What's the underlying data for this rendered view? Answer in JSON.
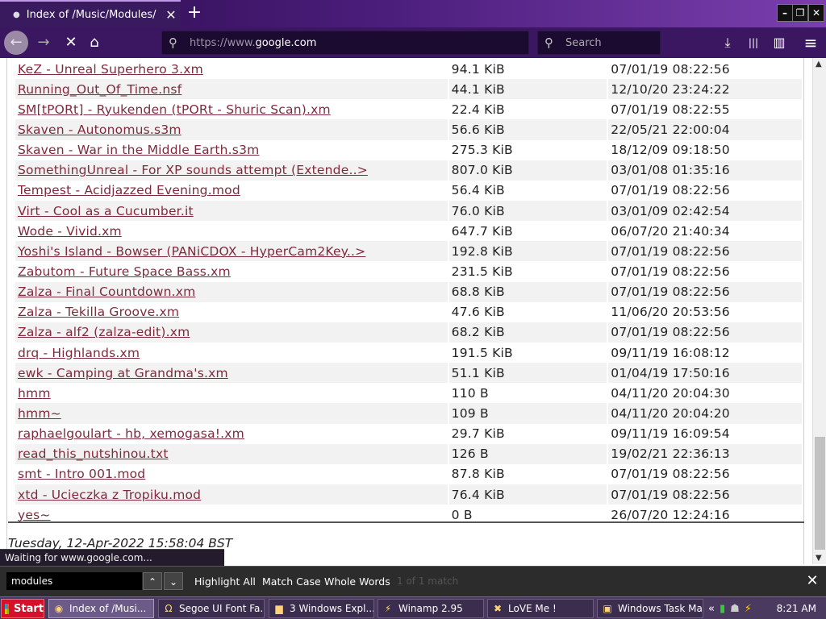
{
  "tab": {
    "title": "Index of /Music/Modules/",
    "close": "✕",
    "new": "+"
  },
  "window_controls": {
    "min": "–",
    "restore": "❐",
    "close": "✕"
  },
  "nav": {
    "back": "←",
    "forward": "→",
    "stop": "✕",
    "home": "⌂"
  },
  "url": {
    "prefix": "https://",
    "host_dim": "www.",
    "host": "google.com"
  },
  "search": {
    "placeholder": "Search"
  },
  "toolbar_icons": {
    "download": "⤓",
    "library": "|||",
    "sidebar": "▥",
    "menu": "≡"
  },
  "files": [
    {
      "name": "KeZ - Unreal Superhero 3.xm",
      "size": "94.1 KiB",
      "date": "07/01/19 08:22:56"
    },
    {
      "name": "Running_Out_Of_Time.nsf",
      "size": "44.1 KiB",
      "date": "12/10/20 23:24:22"
    },
    {
      "name": "SM[tPORt] - Ryukenden (tPORt - Shuric Scan).xm",
      "size": "22.4 KiB",
      "date": "07/01/19 08:22:55"
    },
    {
      "name": "Skaven - Autonomus.s3m",
      "size": "56.6 KiB",
      "date": "22/05/21 22:00:04"
    },
    {
      "name": "Skaven - War in the Middle Earth.s3m",
      "size": "275.3 KiB",
      "date": "18/12/09 09:18:50"
    },
    {
      "name": "SomethingUnreal - For XP sounds attempt (Extende..>",
      "size": "807.0 KiB",
      "date": "03/01/08 01:35:16"
    },
    {
      "name": "Tempest - Acidjazzed Evening.mod",
      "size": "56.4 KiB",
      "date": "07/01/19 08:22:56"
    },
    {
      "name": "Virt - Cool as a Cucumber.it",
      "size": "76.0 KiB",
      "date": "03/01/09 02:42:54"
    },
    {
      "name": "Wode - Vivid.xm",
      "size": "647.7 KiB",
      "date": "06/07/20 21:40:34"
    },
    {
      "name": "Yoshi's Island - Bowser (PANiCDOX - HyperCam2Key..>",
      "size": "192.8 KiB",
      "date": "07/01/19 08:22:56"
    },
    {
      "name": "Zabutom - Future Space Bass.xm",
      "size": "231.5 KiB",
      "date": "07/01/19 08:22:56"
    },
    {
      "name": "Zalza - Final Countdown.xm",
      "size": "68.8 KiB",
      "date": "07/01/19 08:22:56"
    },
    {
      "name": "Zalza - Tekilla Groove.xm",
      "size": "47.6 KiB",
      "date": "11/06/20 20:53:56"
    },
    {
      "name": "Zalza - alf2 (zalza-edit).xm",
      "size": "68.2 KiB",
      "date": "07/01/19 08:22:56"
    },
    {
      "name": "drq - Highlands.xm",
      "size": "191.5 KiB",
      "date": "09/11/19 16:08:12"
    },
    {
      "name": "ewk - Camping at Grandma's.xm",
      "size": "51.1 KiB",
      "date": "01/04/19 17:50:16"
    },
    {
      "name": "hmm",
      "size": "110 B",
      "date": "04/11/20 20:04:30"
    },
    {
      "name": "hmm~",
      "size": "109 B",
      "date": "04/11/20 20:04:20"
    },
    {
      "name": "raphaelgoulart - hb, xemogasa!.xm",
      "size": "29.7 KiB",
      "date": "09/11/19 16:09:54"
    },
    {
      "name": "read_this_nutshinou.txt",
      "size": "126 B",
      "date": "19/02/21 22:36:13"
    },
    {
      "name": "smt - Intro 001.mod",
      "size": "87.8 KiB",
      "date": "07/01/19 08:22:56"
    },
    {
      "name": "xtd - Ucieczka z Tropiku.mod",
      "size": "76.4 KiB",
      "date": "07/01/19 08:22:56"
    },
    {
      "name": "yes~",
      "size": "0 B",
      "date": "26/07/20 12:24:16"
    }
  ],
  "footer": {
    "date": "Tuesday, 12-Apr-2022 15:58:04 BST"
  },
  "status": {
    "text": "Waiting for www.google.com..."
  },
  "find": {
    "value": "modules",
    "prev": "⌃",
    "next": "⌄",
    "highlight_all": "Highlight All",
    "match_case": "Match Case",
    "whole_words": "Whole Words",
    "status": "1 of 1 match",
    "close": "✕"
  },
  "taskbar": {
    "start": "Start",
    "items": [
      {
        "label": "Index of /Musi...",
        "icon": "firefox-icon",
        "glyph": "◉"
      },
      {
        "label": "Segoe UI Font Fa...",
        "icon": "font-icon",
        "glyph": "Ω"
      },
      {
        "label": "3 Windows Expl...",
        "icon": "folder-icon",
        "glyph": "▆"
      },
      {
        "label": "Winamp 2.95",
        "icon": "winamp-icon",
        "glyph": "⚡"
      },
      {
        "label": "LoVE Me !",
        "icon": "xm-icon",
        "glyph": "✖"
      },
      {
        "label": "Windows Task Ma...",
        "icon": "task-manager-icon",
        "glyph": "▣"
      }
    ],
    "tray_expand": "«",
    "clock": "8:21 AM"
  }
}
